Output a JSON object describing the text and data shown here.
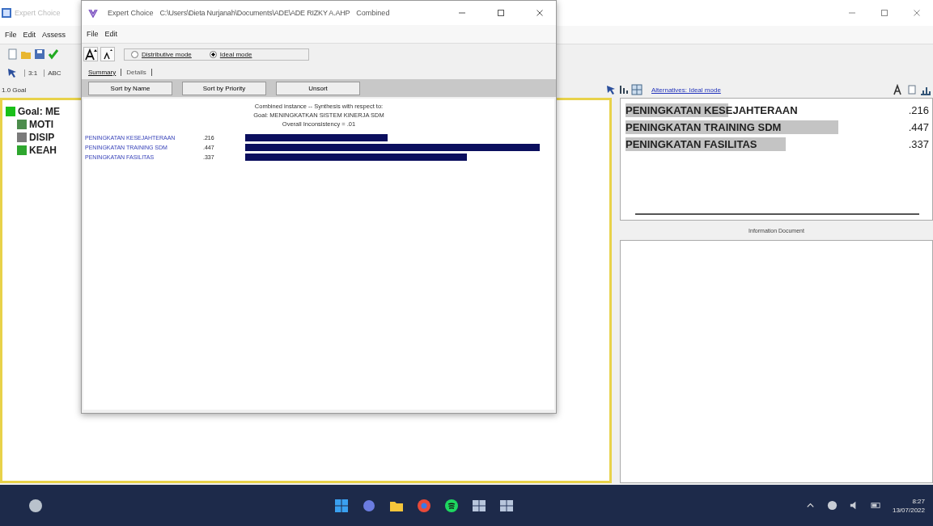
{
  "main_window": {
    "title": "Expert Choice",
    "menu": [
      "File",
      "Edit",
      "Assess"
    ],
    "toolbar2": [
      "3:1",
      "ABC"
    ],
    "node_label": "1.0 Goal",
    "tree": {
      "label": "Goal: ME",
      "color": "#19c019",
      "children": [
        {
          "label": "MOTI",
          "color": "#4c8c4c"
        },
        {
          "label": "DISIP",
          "color": "#7a7a7a"
        },
        {
          "label": "KEAH",
          "color": "#2ea62e"
        }
      ]
    },
    "alternatives": {
      "link": "Alternatives: Ideal mode",
      "rows": [
        {
          "name": "PENINGKATAN KESEJAHTERAAN",
          "value": ".216"
        },
        {
          "name": "PENINGKATAN TRAINING SDM",
          "value": ".447"
        },
        {
          "name": "PENINGKATAN FASILITAS",
          "value": ".337"
        }
      ]
    },
    "info_title": "Information Document"
  },
  "dialog": {
    "title": "Expert Choice",
    "path": "C:\\Users\\Dieta Nurjanah\\Documents\\ADE\\ADE RIZKY A.AHP",
    "mode_label": "Combined",
    "menu": [
      "File",
      "Edit"
    ],
    "modes": [
      {
        "label": "Distributive mode",
        "selected": false
      },
      {
        "label": "Ideal mode",
        "selected": true
      }
    ],
    "tabs": [
      {
        "label": "Summary",
        "selected": true
      },
      {
        "label": "Details",
        "selected": false
      }
    ],
    "buttons": [
      "Sort by Name",
      "Sort by Priority",
      "Unsort"
    ],
    "heading": [
      "Combined instance -- Synthesis with respect to:",
      "Goal: MENINGKATKAN SISTEM KINERJA SDM",
      "Overall Inconsistency = .01"
    ],
    "rows": [
      {
        "name": "PENINGKATAN KESEJAHTERAAN",
        "value": ".216"
      },
      {
        "name": "PENINGKATAN TRAINING SDM",
        "value": ".447"
      },
      {
        "name": "PENINGKATAN FASILITAS",
        "value": ".337"
      }
    ]
  },
  "taskbar": {
    "time": "8:27",
    "date": "13/07/2022"
  }
}
